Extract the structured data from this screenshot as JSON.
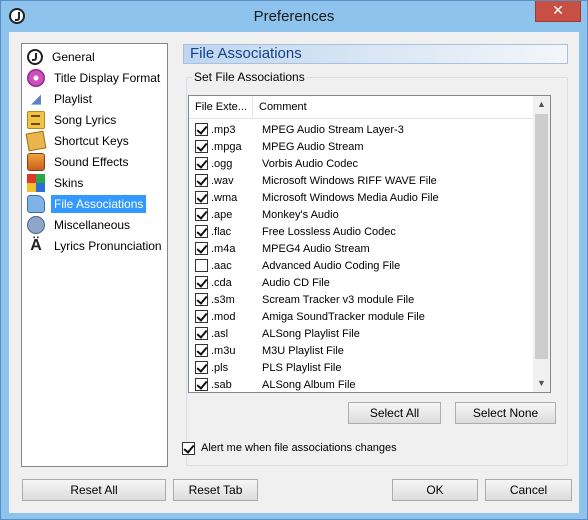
{
  "window": {
    "title": "Preferences",
    "close_symbol": "✕"
  },
  "nav": {
    "items": [
      {
        "label": "General",
        "icon": "general-icon"
      },
      {
        "label": "Title Display Format",
        "icon": "title-display-icon"
      },
      {
        "label": "Playlist",
        "icon": "playlist-icon"
      },
      {
        "label": "Song Lyrics",
        "icon": "song-lyrics-icon"
      },
      {
        "label": "Shortcut Keys",
        "icon": "key-icon"
      },
      {
        "label": "Sound Effects",
        "icon": "sound-effects-icon"
      },
      {
        "label": "Skins",
        "icon": "skins-icon"
      },
      {
        "label": "File Associations",
        "icon": "file-associations-icon",
        "selected": true
      },
      {
        "label": "Miscellaneous",
        "icon": "miscellaneous-icon"
      },
      {
        "label": "Lyrics Pronunciation",
        "icon": "lyrics-pronunciation-icon",
        "glyph": "Ä"
      }
    ]
  },
  "panel": {
    "header": "File Associations",
    "group_title": "Set File Associations",
    "columns": {
      "ext": "File Exte...",
      "comment": "Comment"
    },
    "rows": [
      {
        "ext": ".mp3",
        "comment": "MPEG Audio Stream Layer-3",
        "checked": true
      },
      {
        "ext": ".mpga",
        "comment": "MPEG Audio Stream",
        "checked": true
      },
      {
        "ext": ".ogg",
        "comment": "Vorbis Audio Codec",
        "checked": true
      },
      {
        "ext": ".wav",
        "comment": "Microsoft Windows RIFF WAVE File",
        "checked": true
      },
      {
        "ext": ".wma",
        "comment": "Microsoft Windows Media Audio File",
        "checked": true
      },
      {
        "ext": ".ape",
        "comment": "Monkey's Audio",
        "checked": true
      },
      {
        "ext": ".flac",
        "comment": "Free Lossless Audio Codec",
        "checked": true
      },
      {
        "ext": ".m4a",
        "comment": "MPEG4 Audio Stream",
        "checked": true
      },
      {
        "ext": ".aac",
        "comment": "Advanced Audio Coding File",
        "checked": false
      },
      {
        "ext": ".cda",
        "comment": "Audio CD File",
        "checked": true
      },
      {
        "ext": ".s3m",
        "comment": "Scream Tracker v3 module File",
        "checked": true
      },
      {
        "ext": ".mod",
        "comment": "Amiga SoundTracker module File",
        "checked": true
      },
      {
        "ext": ".asl",
        "comment": "ALSong Playlist File",
        "checked": true
      },
      {
        "ext": ".m3u",
        "comment": "M3U Playlist File",
        "checked": true
      },
      {
        "ext": ".pls",
        "comment": "PLS Playlist File",
        "checked": true
      },
      {
        "ext": ".sab",
        "comment": "ALSong Album File",
        "checked": true
      }
    ],
    "select_all": "Select All",
    "select_none": "Select None",
    "alert_label": "Alert me when file associations changes",
    "alert_checked": true
  },
  "footer": {
    "reset_all": "Reset All",
    "reset_tab": "Reset Tab",
    "ok": "OK",
    "cancel": "Cancel"
  }
}
